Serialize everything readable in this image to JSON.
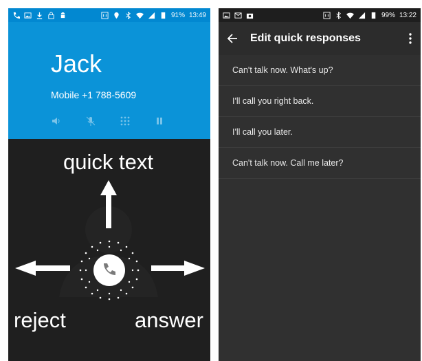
{
  "left": {
    "status_bar": {
      "battery": "91%",
      "time": "13:49"
    },
    "caller": {
      "name": "Jack",
      "number": "Mobile +1 788-5609"
    },
    "controls": [
      "speaker-icon",
      "mute-icon",
      "dialpad-icon",
      "hold-icon"
    ],
    "labels": {
      "quick_text": "quick text",
      "reject": "reject",
      "answer": "answer"
    },
    "colors": {
      "header": "#0b93d8",
      "background": "#1f1f1f"
    }
  },
  "right": {
    "status_bar": {
      "battery": "99%",
      "time": "13:22"
    },
    "appbar": {
      "title": "Edit quick responses"
    },
    "responses": [
      "Can't talk now. What's up?",
      "I'll call you right back.",
      "I'll call you later.",
      "Can't talk now. Call me later?"
    ]
  }
}
